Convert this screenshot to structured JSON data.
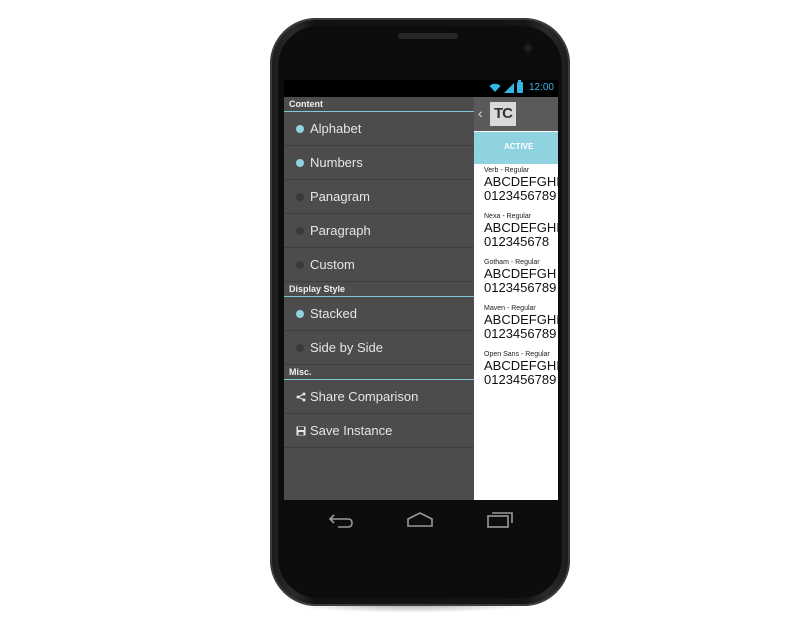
{
  "status_bar": {
    "time": "12:00"
  },
  "drawer": {
    "sections": [
      {
        "header": "Content",
        "items": [
          {
            "label": "Alphabet",
            "selected": true
          },
          {
            "label": "Numbers",
            "selected": true
          },
          {
            "label": "Panagram",
            "selected": false
          },
          {
            "label": "Paragraph",
            "selected": false
          },
          {
            "label": "Custom",
            "selected": false
          }
        ]
      },
      {
        "header": "Display Style",
        "items": [
          {
            "label": "Stacked",
            "selected": true
          },
          {
            "label": "Side by Side",
            "selected": false
          }
        ]
      },
      {
        "header": "Misc.",
        "items": [
          {
            "label": "Share Comparison",
            "icon": "share-icon"
          },
          {
            "label": "Save Instance",
            "icon": "save-icon"
          }
        ]
      }
    ]
  },
  "app": {
    "logo": "TC",
    "active_tab": "ACTIVE"
  },
  "samples": [
    {
      "name": "Verb - Regular",
      "alpha": "ABCDEFGHIJ",
      "nums": "0123456789"
    },
    {
      "name": "Nexa - Regular",
      "alpha": "ABCDEFGHI",
      "nums": "012345678"
    },
    {
      "name": "Gotham - Regular",
      "alpha": "ABCDEFGH",
      "nums": "0123456789"
    },
    {
      "name": "Maven - Regular",
      "alpha": "ABCDEFGHIJ",
      "nums": "0123456789"
    },
    {
      "name": "Open Sans - Regular",
      "alpha": "ABCDEFGHI",
      "nums": "0123456789"
    }
  ],
  "navigation": {
    "buttons": [
      "back-icon",
      "home-icon",
      "recents-icon"
    ]
  },
  "colors": {
    "accent": "#8fd3e0",
    "status": "#33b5e5",
    "drawer_bg": "#4c4c4c"
  }
}
